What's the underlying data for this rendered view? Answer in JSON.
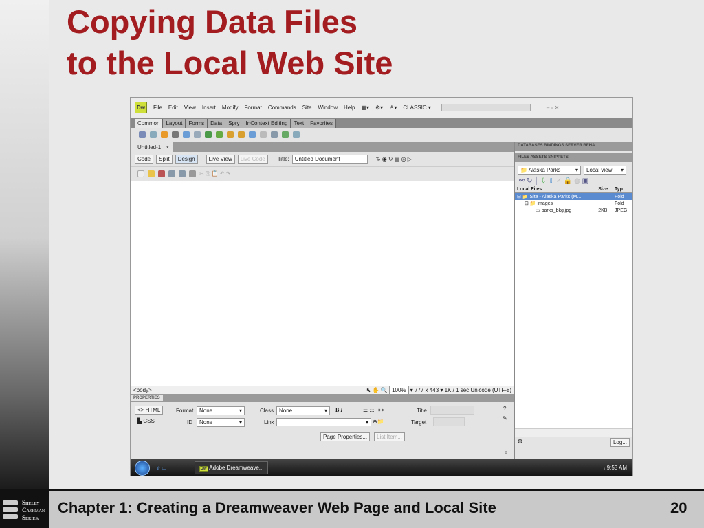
{
  "slide": {
    "title_line1": "Copying Data Files",
    "title_line2": "to the Local Web Site",
    "footer_text": "Chapter 1: Creating a Dreamweaver Web Page and Local Site",
    "page_number": "20",
    "logo_text": [
      "Shelly",
      "Cashman",
      "Series."
    ]
  },
  "app": {
    "logo": "Dw",
    "menu": [
      "File",
      "Edit",
      "View",
      "Insert",
      "Modify",
      "Format",
      "Commands",
      "Site",
      "Window",
      "Help"
    ],
    "workspace": "CLASSIC",
    "insert_tabs": [
      "Common",
      "Layout",
      "Forms",
      "Data",
      "Spry",
      "InContext Editing",
      "Text",
      "Favorites"
    ],
    "document_tab": "Untitled-1",
    "doc_toolbar": {
      "code": "Code",
      "split": "Split",
      "design": "Design",
      "live_view": "Live View",
      "live_code": "Live Code",
      "title_label": "Title:",
      "title_value": "Untitled Document"
    },
    "status": {
      "tag": "<body>",
      "zoom": "100%",
      "size": "777 x 443",
      "download": "1K / 1 sec",
      "encoding": "Unicode (UTF-8)"
    },
    "properties": {
      "header": "PROPERTIES",
      "html": "HTML",
      "css": "CSS",
      "format_label": "Format",
      "format_value": "None",
      "id_label": "ID",
      "id_value": "None",
      "class_label": "Class",
      "class_value": "None",
      "link_label": "Link",
      "link_value": "",
      "title_label": "Title",
      "target_label": "Target",
      "page_properties": "Page Properties...",
      "list_item": "List Item..."
    },
    "panels": {
      "tabs1": [
        "DATABASES",
        "BINDINGS",
        "SERVER BEHA"
      ],
      "tabs2": [
        "FILES",
        "ASSETS",
        "SNIPPETS"
      ],
      "site": "Alaska Parks",
      "view": "Local view",
      "col_local": "Local Files",
      "col_size": "Size",
      "col_type": "Typ",
      "files": [
        {
          "name": "Site - Alaska Parks (M...",
          "size": "",
          "type": "Fold"
        },
        {
          "name": "images",
          "size": "",
          "type": "Fold"
        },
        {
          "name": "parks_bkg.jpg",
          "size": "2KB",
          "type": "JPEG"
        }
      ],
      "log": "Log..."
    },
    "taskbar": {
      "task": "Adobe Dreamweave...",
      "time": "9:53 AM"
    }
  }
}
